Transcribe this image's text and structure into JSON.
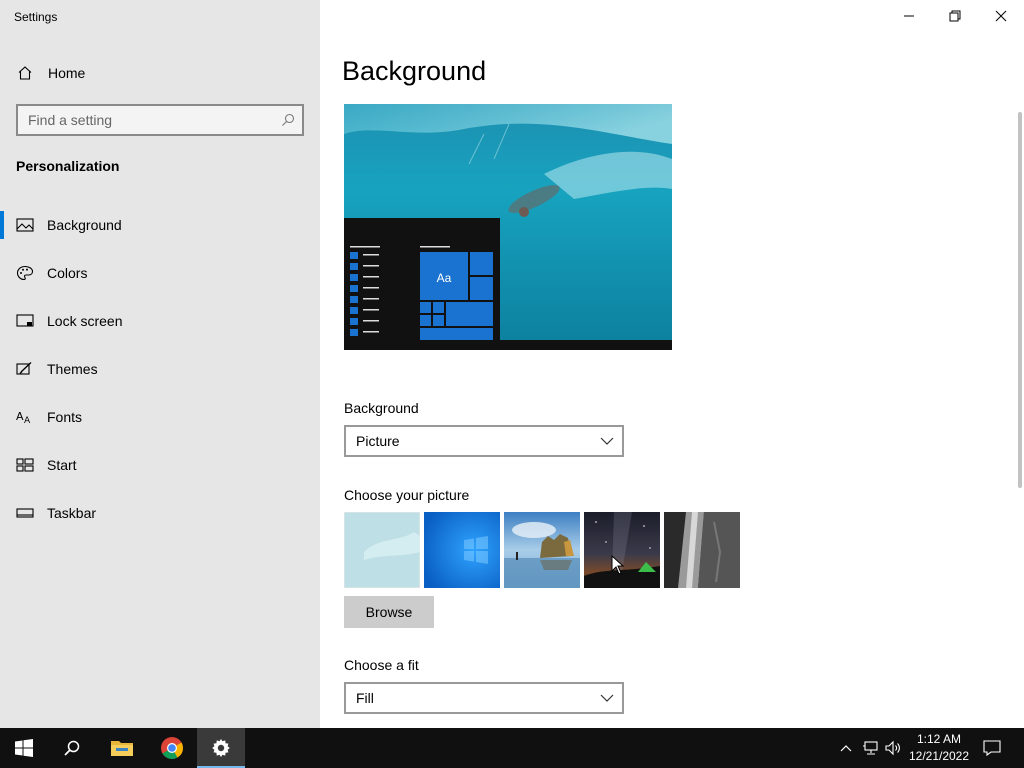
{
  "window": {
    "title": "Settings",
    "minimize_icon": "minimize-icon",
    "restore_icon": "restore-icon",
    "close_icon": "close-icon"
  },
  "sidebar": {
    "home_label": "Home",
    "search_placeholder": "Find a setting",
    "section_title": "Personalization",
    "items": [
      {
        "label": "Background",
        "icon": "picture-icon",
        "active": true
      },
      {
        "label": "Colors",
        "icon": "palette-icon",
        "active": false
      },
      {
        "label": "Lock screen",
        "icon": "lock-screen-icon",
        "active": false
      },
      {
        "label": "Themes",
        "icon": "themes-icon",
        "active": false
      },
      {
        "label": "Fonts",
        "icon": "fonts-icon",
        "active": false
      },
      {
        "label": "Start",
        "icon": "start-icon",
        "active": false
      },
      {
        "label": "Taskbar",
        "icon": "taskbar-icon",
        "active": false
      }
    ]
  },
  "main": {
    "title": "Background",
    "preview": {
      "tile_text": "Aa"
    },
    "background_label": "Background",
    "background_value": "Picture",
    "choose_picture_label": "Choose your picture",
    "browse_label": "Browse",
    "fit_label": "Choose a fit",
    "fit_value": "Fill"
  },
  "taskbar": {
    "time": "1:12 AM",
    "date": "12/21/2022",
    "apps": [
      "start-icon",
      "search-icon",
      "file-explorer-icon",
      "chrome-icon",
      "settings-gear-icon"
    ]
  },
  "colors": {
    "accent": "#0078d7",
    "sidebar_bg": "#e6e6e6",
    "taskbar_bg": "#101010"
  }
}
